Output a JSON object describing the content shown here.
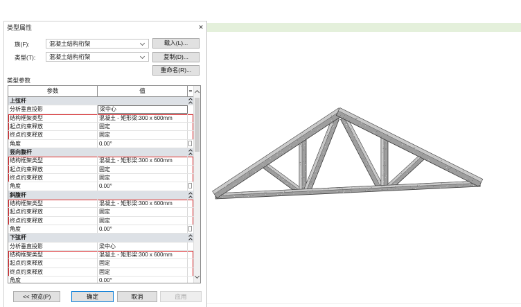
{
  "window": {
    "title": "类型属性",
    "close_glyph": "×"
  },
  "family": {
    "label": "族(F):",
    "value": "混凝土结构桁架"
  },
  "type": {
    "label": "类型(T):",
    "value": "混凝土结构桁架"
  },
  "buttons": {
    "load": "载入(L)...",
    "duplicate": "复制(D)...",
    "rename": "重命名(R)...",
    "preview": "<< 预览(P)",
    "ok": "确定",
    "cancel": "取消",
    "apply": "应用"
  },
  "type_params": {
    "label": "类型参数",
    "header": {
      "param": "参数",
      "value": "值",
      "eq": "="
    },
    "groups": [
      {
        "name": "上弦杆",
        "rows": [
          {
            "param": "分析垂直投影",
            "value": "梁中心"
          },
          {
            "param": "结构框架类型",
            "value": "混凝土 - 矩形梁:300 x 600mm"
          },
          {
            "param": "起点约束释放",
            "value": "固定"
          },
          {
            "param": "终点约束释放",
            "value": "固定"
          },
          {
            "param": "角度",
            "value": "0.00°"
          }
        ]
      },
      {
        "name": "竖向腹杆",
        "rows": [
          {
            "param": "结构框架类型",
            "value": "混凝土 - 矩形梁:300 x 600mm"
          },
          {
            "param": "起点约束释放",
            "value": "固定"
          },
          {
            "param": "终点约束释放",
            "value": "固定"
          },
          {
            "param": "角度",
            "value": "0.00°"
          }
        ]
      },
      {
        "name": "斜腹杆",
        "rows": [
          {
            "param": "结构框架类型",
            "value": "混凝土 - 矩形梁:300 x 600mm"
          },
          {
            "param": "起点约束释放",
            "value": "固定"
          },
          {
            "param": "终点约束释放",
            "value": "固定"
          },
          {
            "param": "角度",
            "value": "0.00°"
          }
        ]
      },
      {
        "name": "下弦杆",
        "rows": [
          {
            "param": "分析垂直投影",
            "value": "梁中心"
          },
          {
            "param": "结构框架类型",
            "value": "混凝土 - 矩形梁:300 x 600mm"
          },
          {
            "param": "起点约束释放",
            "value": "固定"
          },
          {
            "param": "终点约束释放",
            "value": "固定"
          },
          {
            "param": "角度",
            "value": "0.00°"
          }
        ]
      }
    ]
  },
  "colors": {
    "highlight": "#d9262a",
    "default_button_border": "#0078d7",
    "view_strip": "#e4f0db",
    "concrete": "#9e9e9e",
    "concrete_face": "#c9c9c9"
  },
  "icons": {
    "close": "close-icon",
    "dropdown": "chevron-down-icon",
    "collapse": "double-chevron-up-icon",
    "scroll_up": "scroll-up-icon",
    "scroll_down": "scroll-down-icon"
  }
}
